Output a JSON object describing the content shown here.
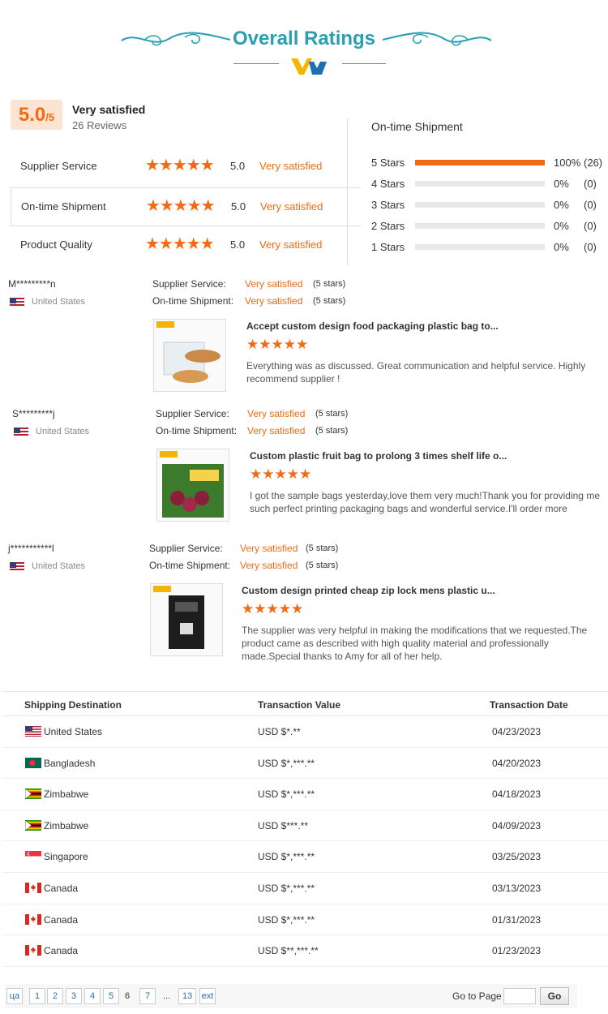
{
  "header": {
    "title": "Overall Ratings"
  },
  "summary": {
    "score": "5.0",
    "score_suffix": "/5",
    "label": "Very satisfied",
    "reviews": "26 Reviews"
  },
  "ratings": [
    {
      "label": "Supplier Service",
      "stars": "★★★★★",
      "value": "5.0",
      "text": "Very satisfied"
    },
    {
      "label": "On-time Shipment",
      "stars": "★★★★★",
      "value": "5.0",
      "text": "Very satisfied"
    },
    {
      "label": "Product Quality",
      "stars": "★★★★★",
      "value": "5.0",
      "text": "Very satisfied"
    }
  ],
  "distribution": {
    "title": "On-time Shipment",
    "rows": [
      {
        "label": "5  Stars",
        "fraction": 1.0,
        "percent": "100%",
        "count": "(26)"
      },
      {
        "label": "4  Stars",
        "fraction": 0,
        "percent": "0%",
        "count": "(0)"
      },
      {
        "label": "3  Stars",
        "fraction": 0,
        "percent": "0%",
        "count": "(0)"
      },
      {
        "label": "2  Stars",
        "fraction": 0,
        "percent": "0%",
        "count": "(0)"
      },
      {
        "label": "1  Stars",
        "fraction": 0,
        "percent": "0%",
        "count": "(0)"
      }
    ]
  },
  "reviews": [
    {
      "name": "M*********n",
      "country": "United States",
      "service_label": "Supplier Service:",
      "service_value": "Very satisfied",
      "service_stars": "(5 stars)",
      "shipment_label": "On-time Shipment:",
      "shipment_value": "Very satisfied",
      "shipment_stars": "(5 stars)",
      "product": "Accept custom design food packaging plastic bag to...",
      "stars": "★★★★★",
      "text": "Everything was as discussed. Great communication and helpful service. Highly recommend supplier !"
    },
    {
      "name": "S*********j",
      "country": "United States",
      "service_label": "Supplier Service:",
      "service_value": "Very satisfied",
      "service_stars": "(5 stars)",
      "shipment_label": "On-time Shipment:",
      "shipment_value": "Very satisfied",
      "shipment_stars": "(5 stars)",
      "product": "Custom plastic fruit bag to prolong 3 times shelf life o...",
      "stars": "★★★★★",
      "text": "I got the sample bags yesterday,love them very much!Thank you for providing me such  perfect printing packaging bags and wonderful service.I'll order more"
    },
    {
      "name": "j***********l",
      "country": "United States",
      "service_label": "Supplier Service:",
      "service_value": "Very satisfied",
      "service_stars": "(5 stars)",
      "shipment_label": "On-time Shipment:",
      "shipment_value": "Very satisfied",
      "shipment_stars": "(5 stars)",
      "product": "Custom design printed cheap zip lock mens plastic u...",
      "stars": "★★★★★",
      "text": "The supplier was very helpful in making the modifications that we requested.The product came as described with high quality material and professionally made.Special thanks to Amy for all of her help."
    }
  ],
  "transactions": {
    "headers": [
      "Shipping Destination",
      "Transaction Value",
      "Transaction Date"
    ],
    "rows": [
      {
        "country": "United States",
        "flag": "us",
        "value": "USD $*.**",
        "date": "04/23/2023"
      },
      {
        "country": "Bangladesh",
        "flag": "bd",
        "value": "USD $*,***.**",
        "date": "04/20/2023"
      },
      {
        "country": "Zimbabwe",
        "flag": "zw",
        "value": "USD $*,***.**",
        "date": "04/18/2023"
      },
      {
        "country": "Zimbabwe",
        "flag": "zw",
        "value": "USD $***.**",
        "date": "04/09/2023"
      },
      {
        "country": "Singapore",
        "flag": "sg",
        "value": "USD $*,***.**",
        "date": "03/25/2023"
      },
      {
        "country": "Canada",
        "flag": "ca",
        "value": "USD $*,***.**",
        "date": "03/13/2023"
      },
      {
        "country": "Canada",
        "flag": "ca",
        "value": "USD $*,***.**",
        "date": "01/31/2023"
      },
      {
        "country": "Canada",
        "flag": "ca",
        "value": "USD $**,***.**",
        "date": "01/23/2023"
      }
    ]
  },
  "pagination": {
    "prev": "ца",
    "pages": [
      "1",
      "2",
      "3",
      "4",
      "5"
    ],
    "current": "6",
    "next_page": "7",
    "ellipsis": "...",
    "last": "13",
    "next": "ext",
    "goto_label": "Go to Page",
    "go": "Go"
  },
  "colors": {
    "accent": "#f26b12",
    "title": "#2a9fb3",
    "link": "#2a6fbd"
  }
}
